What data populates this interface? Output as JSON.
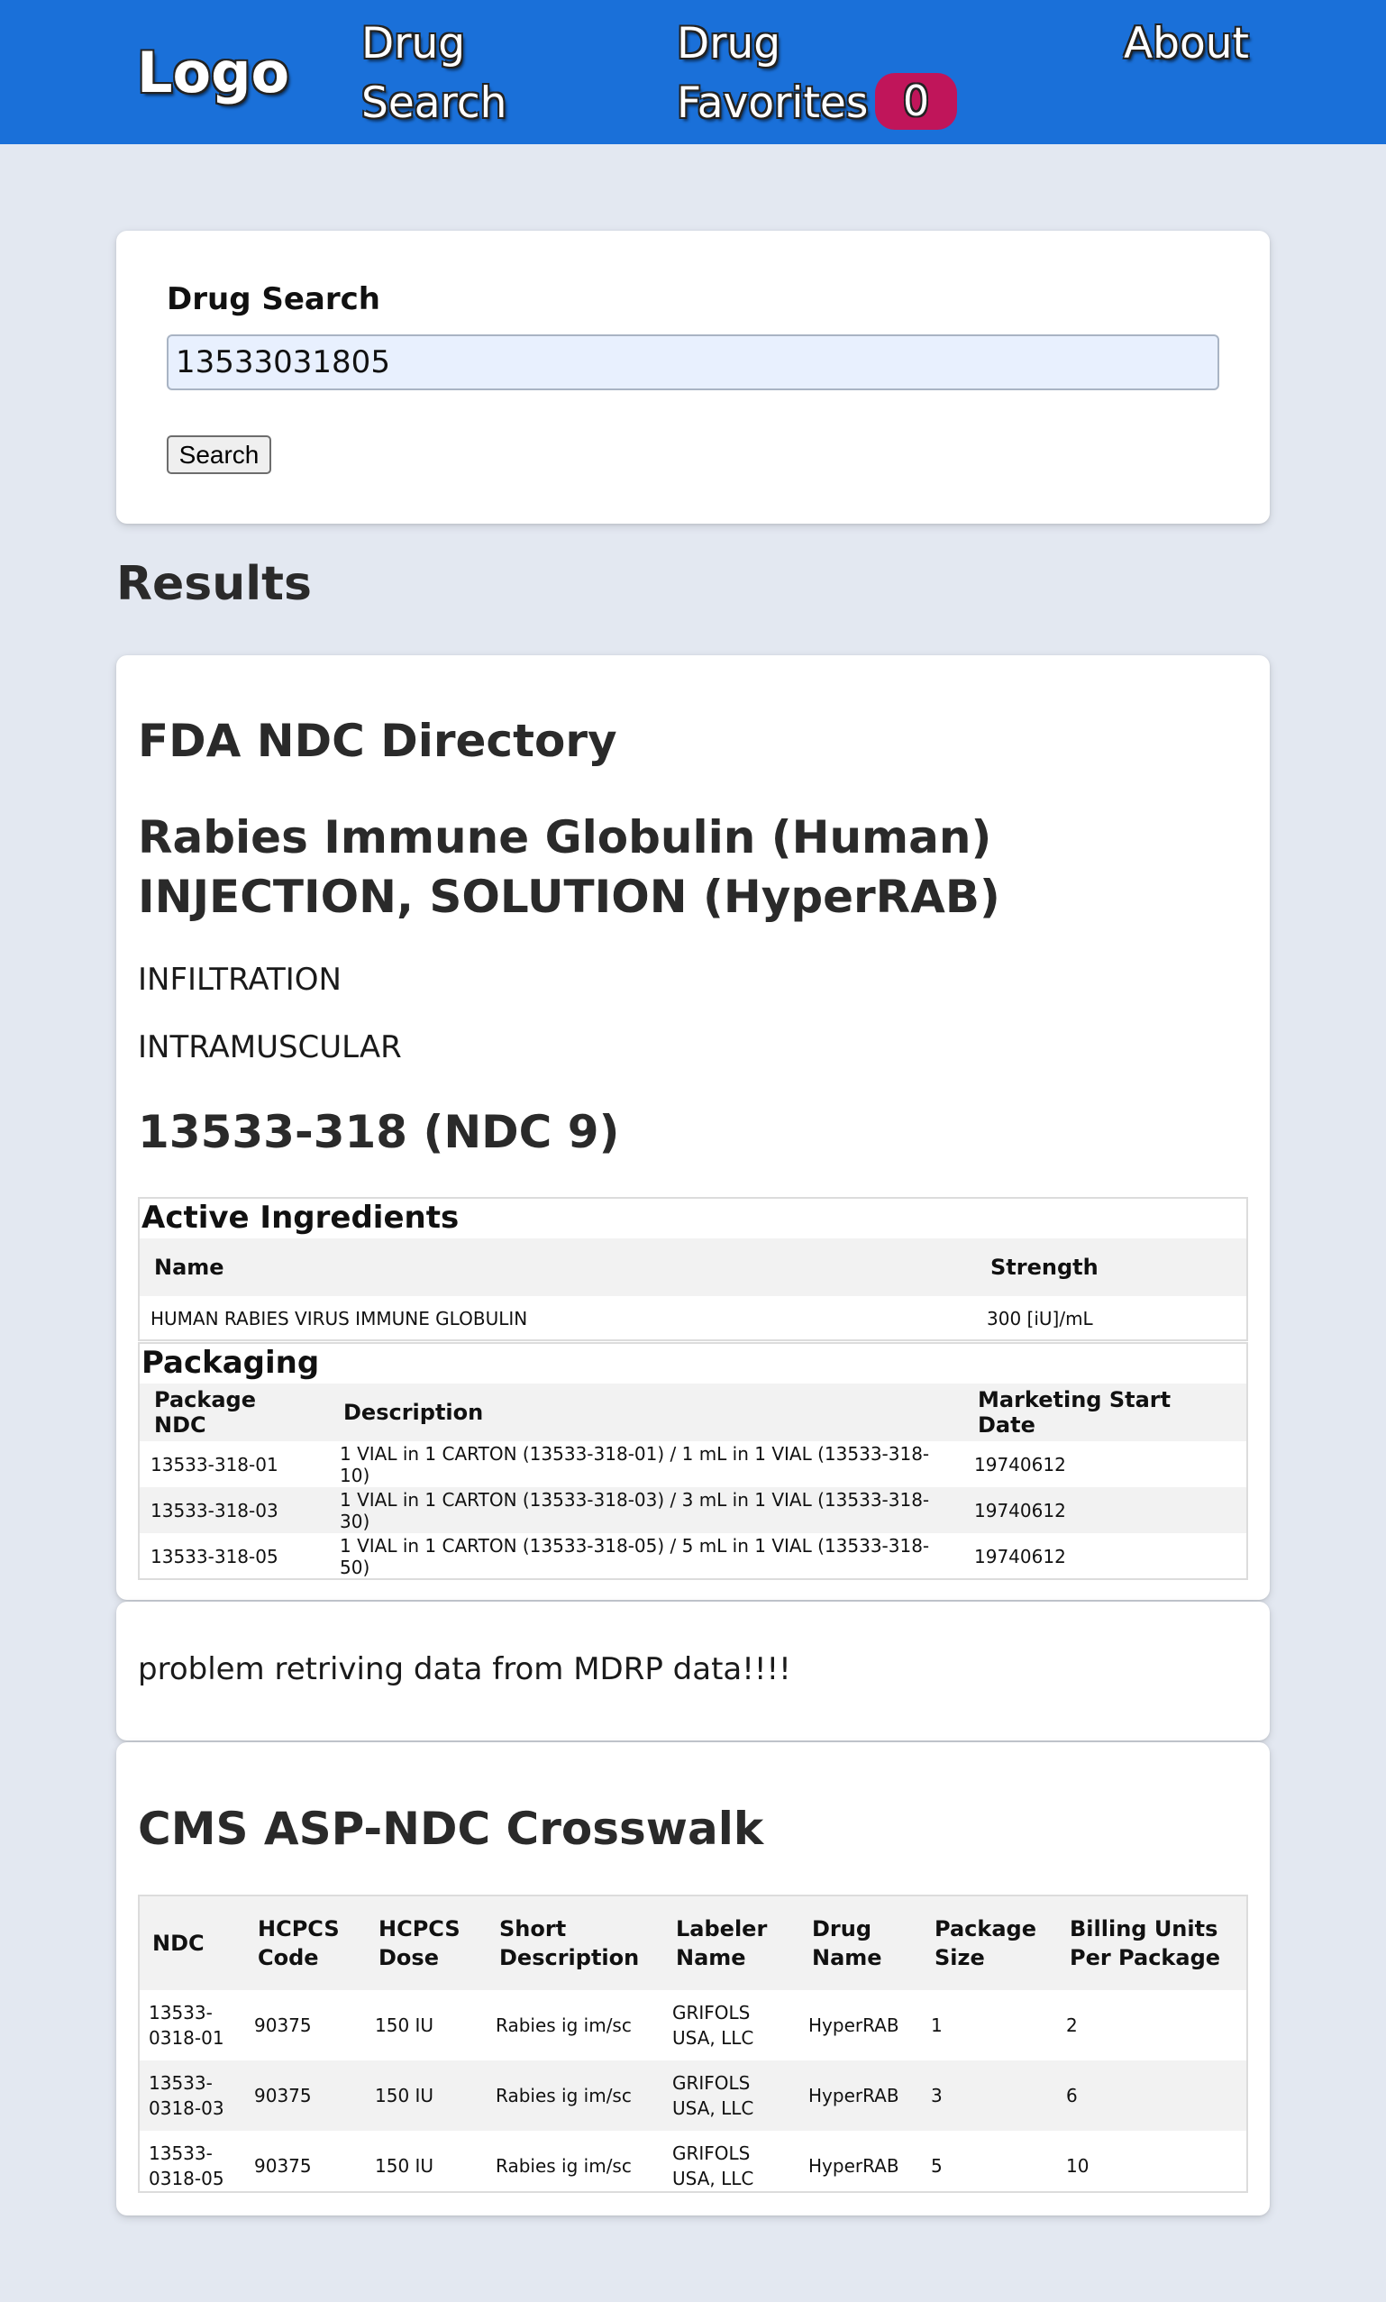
{
  "nav": {
    "logo": "Logo",
    "drug_search": "Drug Search",
    "drug_favorites": "Drug Favorites",
    "favorites_count": "0",
    "about": "About",
    "bar_color": "#1a70d9",
    "badge_color": "#c0155a"
  },
  "search": {
    "label": "Drug Search",
    "value": "13533031805",
    "button": "Search"
  },
  "results_heading": "Results",
  "fda": {
    "heading": "FDA NDC Directory",
    "drug_title": "Rabies Immune Globulin (Human) INJECTION, SOLUTION (HyperRAB)",
    "routes": [
      "INFILTRATION",
      "INTRAMUSCULAR"
    ],
    "ndc9": "13533-318 (NDC 9)",
    "active_ingredients": {
      "caption": "Active Ingredients",
      "headers": [
        "Name",
        "Strength"
      ],
      "rows": [
        [
          "HUMAN RABIES VIRUS IMMUNE GLOBULIN",
          "300 [iU]/mL"
        ]
      ]
    },
    "packaging": {
      "caption": "Packaging",
      "headers": [
        "Package NDC",
        "Description",
        "Marketing Start Date"
      ],
      "rows": [
        [
          "13533-318-01",
          "1 VIAL in 1 CARTON (13533-318-01) / 1 mL in 1 VIAL (13533-318-10)",
          "19740612"
        ],
        [
          "13533-318-03",
          "1 VIAL in 1 CARTON (13533-318-03) / 3 mL in 1 VIAL (13533-318-30)",
          "19740612"
        ],
        [
          "13533-318-05",
          "1 VIAL in 1 CARTON (13533-318-05) / 5 mL in 1 VIAL (13533-318-50)",
          "19740612"
        ]
      ]
    }
  },
  "mdrp": {
    "message": "problem retriving data from MDRP data!!!!"
  },
  "cms": {
    "heading": "CMS ASP-NDC Crosswalk",
    "headers": [
      "NDC",
      "HCPCS Code",
      "HCPCS Dose",
      "Short Description",
      "Labeler Name",
      "Drug Name",
      "Package Size",
      "Billing Units Per Package"
    ],
    "rows": [
      [
        "13533-0318-01",
        "90375",
        "150 IU",
        "Rabies ig im/sc",
        "GRIFOLS USA, LLC",
        "HyperRAB",
        "1",
        "2"
      ],
      [
        "13533-0318-03",
        "90375",
        "150 IU",
        "Rabies ig im/sc",
        "GRIFOLS USA, LLC",
        "HyperRAB",
        "3",
        "6"
      ],
      [
        "13533-0318-05",
        "90375",
        "150 IU",
        "Rabies ig im/sc",
        "GRIFOLS USA, LLC",
        "HyperRAB",
        "5",
        "10"
      ]
    ]
  }
}
